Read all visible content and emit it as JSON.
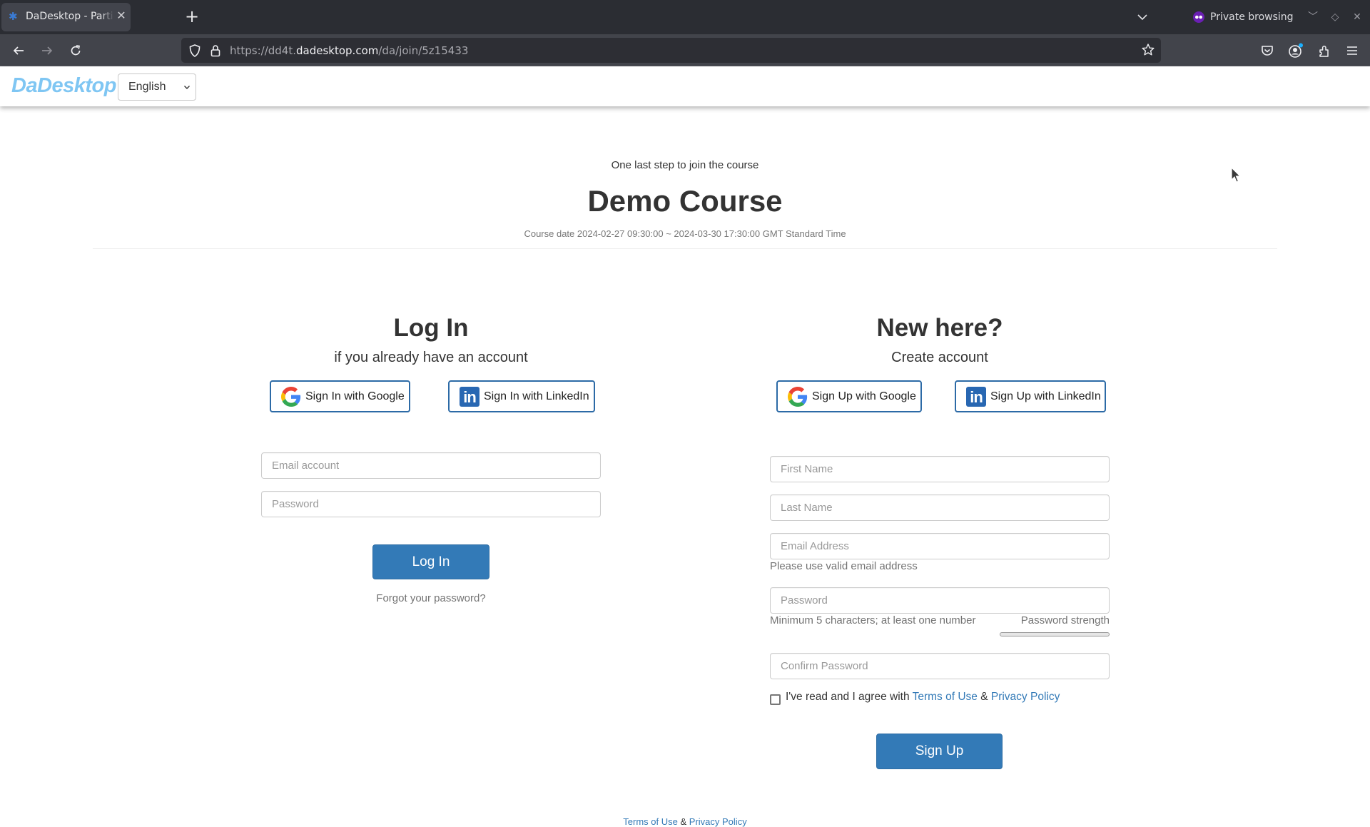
{
  "browser": {
    "tab": {
      "title": "DaDesktop - Participant Join",
      "favicon": "dadesktop-favicon"
    },
    "new_tab_label": "+",
    "private_label": "Private browsing",
    "url": {
      "prefix": "https://dd4t.",
      "domain": "dadesktop.com",
      "path": "/da/join/5z15433"
    },
    "toolbar_icons": [
      "pocket-icon",
      "account-icon",
      "extensions-icon",
      "menu-icon"
    ]
  },
  "site": {
    "logo": "DaDesktop",
    "language": {
      "selected": "English"
    }
  },
  "course": {
    "step_text": "One last step to join the course",
    "title": "Demo Course",
    "date_text": "Course date 2024-02-27 09:30:00 ~ 2024-03-30 17:30:00 GMT Standard Time"
  },
  "login": {
    "heading": "Log In",
    "subheading": "if you already have an account",
    "google_label": "Sign In with Google",
    "linkedin_label": "Sign In with LinkedIn",
    "email": {
      "placeholder": "Email account",
      "value": ""
    },
    "password": {
      "placeholder": "Password",
      "value": ""
    },
    "submit_label": "Log In",
    "forgot_label": "Forgot your password?"
  },
  "signup": {
    "heading": "New here?",
    "subheading": "Create account",
    "google_label": "Sign Up with Google",
    "linkedin_label": "Sign Up with LinkedIn",
    "first_name": {
      "placeholder": "First Name",
      "value": ""
    },
    "last_name": {
      "placeholder": "Last Name",
      "value": ""
    },
    "email": {
      "placeholder": "Email Address",
      "value": "",
      "hint": "Please use valid email address"
    },
    "password": {
      "placeholder": "Password",
      "value": "",
      "hint": "Minimum 5 characters; at least one number",
      "strength_label": "Password strength",
      "strength_percent": 0
    },
    "confirm_password": {
      "placeholder": "Confirm Password",
      "value": ""
    },
    "agree": {
      "checked": false,
      "prefix": "I've read and I agree with ",
      "terms_label": "Terms of Use",
      "amp": " & ",
      "privacy_label": "Privacy Policy"
    },
    "submit_label": "Sign Up"
  },
  "footer": {
    "terms_label": "Terms of Use",
    "amp": " & ",
    "privacy_label": "Privacy Policy"
  },
  "colors": {
    "primary": "#337ab7",
    "logo": "#7fc6f3",
    "linkedin": "#2867b2",
    "private_purple": "#6a1fb3"
  }
}
